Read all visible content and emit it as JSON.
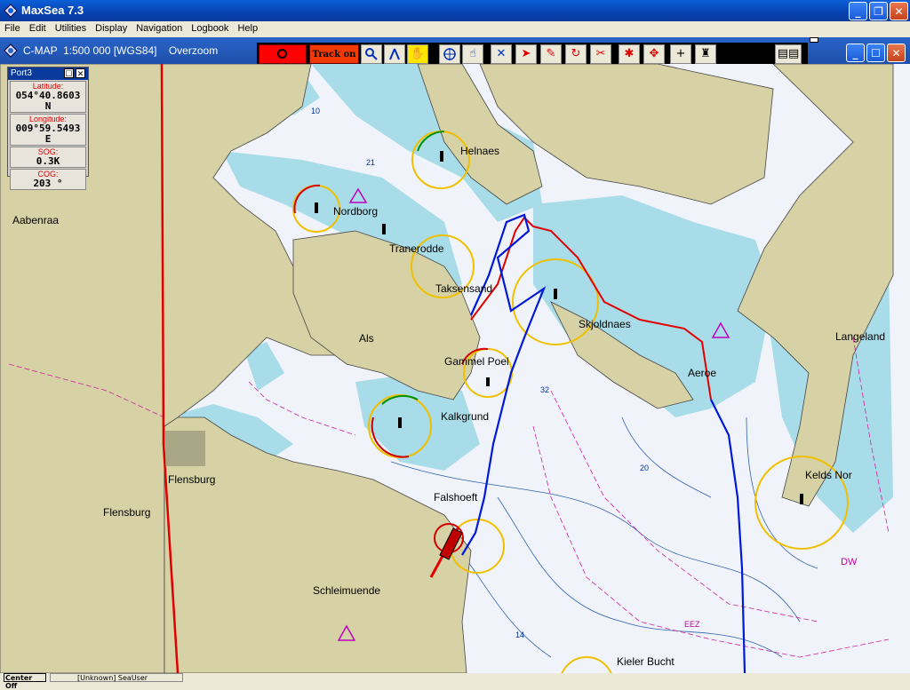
{
  "window": {
    "title": "MaxSea 7.3"
  },
  "menu": [
    "File",
    "Edit",
    "Utilities",
    "Display",
    "Navigation",
    "Logbook",
    "Help"
  ],
  "chart": {
    "info": "C-MAP  1:500 000 [WGS84]    Overzoom"
  },
  "toolbar": {
    "track_label": "Track on"
  },
  "gps": {
    "title": "Port3",
    "fields": [
      {
        "label": "Latitude:",
        "value": "054°40.8603 N"
      },
      {
        "label": "Longitude:",
        "value": "009°59.5493 E"
      },
      {
        "label": "SOG:",
        "value": "0.3K"
      },
      {
        "label": "COG:",
        "value": "203 °"
      }
    ]
  },
  "places": {
    "aabenraa": "Aabenraa",
    "helnaes": "Helnaes",
    "nordborg": "Nordborg",
    "tranerodde": "Tranerodde",
    "taksensand": "Taksensand",
    "als": "Als",
    "skjoldnaes": "Skjoldnaes",
    "langeland": "Langeland",
    "aeroe": "Aeroe",
    "gammel_poel": "Gammel Poel",
    "kalkgrund": "Kalkgrund",
    "flensburg_1": "Flensburg",
    "flensburg_2": "Flensburg",
    "falshoeft": "Falshoeft",
    "keldsnor": "Kelds Nor",
    "schleimuende": "Schleimuende",
    "kieler_bucht": "Kieler Bucht"
  },
  "depths": [
    "21",
    "32",
    "14",
    "10",
    "20",
    "EEZ",
    "DW"
  ],
  "status": {
    "left": "Center Off",
    "middle": "[Unknown]  SeaUser"
  },
  "colors": {
    "land": "#d6d2a5",
    "shallow": "#a8dce8",
    "deep": "#f0f4fa",
    "track_blue": "#0018d8",
    "track_red": "#e00000"
  }
}
